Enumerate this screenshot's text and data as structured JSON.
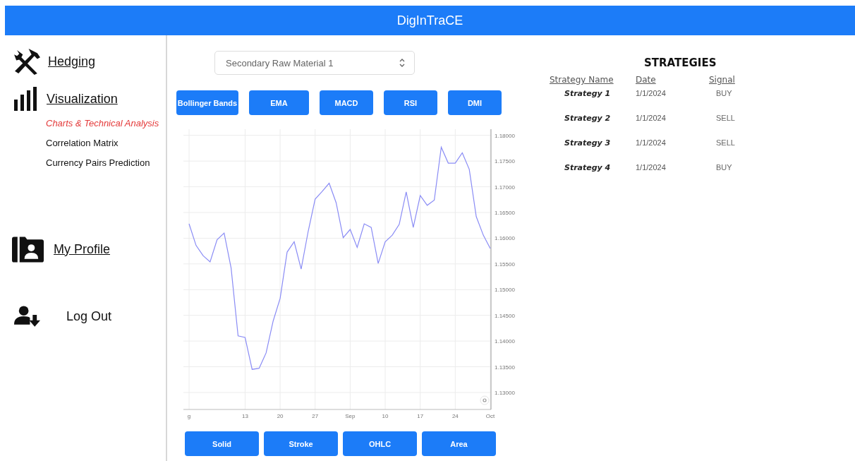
{
  "header": {
    "title": "DigInTraCE"
  },
  "sidebar": {
    "hedging": {
      "label": "Hedging"
    },
    "visualization": {
      "label": "Visualization",
      "children": [
        {
          "label": "Charts & Technical Analysis",
          "selected": true
        },
        {
          "label": "Correlation Matrix",
          "selected": false
        },
        {
          "label": "Currency Pairs Prediction",
          "selected": false
        }
      ]
    },
    "profile": {
      "label": "My Profile"
    },
    "logout": {
      "label": "Log Out"
    }
  },
  "material_select": {
    "value": "Secondary Raw Material 1"
  },
  "indicator_buttons": [
    "Bollinger Bands",
    "EMA",
    "MACD",
    "RSI",
    "DMI"
  ],
  "chart_data": {
    "type": "line",
    "categories": [
      "g",
      null,
      null,
      null,
      null,
      null,
      null,
      null,
      "13",
      null,
      null,
      null,
      null,
      "20",
      null,
      null,
      null,
      null,
      "27",
      null,
      null,
      null,
      null,
      "Sep",
      null,
      null,
      null,
      null,
      "10",
      null,
      null,
      null,
      null,
      "17",
      null,
      null,
      null,
      null,
      "24",
      null,
      null,
      null,
      null,
      "Oct"
    ],
    "series": [
      {
        "color": "#8a8cf5",
        "values": [
          1.1628,
          1.1586,
          1.1566,
          1.1554,
          1.1597,
          1.161,
          1.1542,
          1.141,
          1.1407,
          1.1345,
          1.1347,
          1.1377,
          1.1439,
          1.1483,
          1.1573,
          1.1593,
          1.154,
          1.1613,
          1.1676,
          1.1691,
          1.1707,
          1.1669,
          1.1601,
          1.1617,
          1.1582,
          1.1628,
          1.1621,
          1.1551,
          1.1593,
          1.1606,
          1.1627,
          1.169,
          1.1621,
          1.1683,
          1.1664,
          1.1674,
          1.1777,
          1.1746,
          1.1746,
          1.1766,
          1.1734,
          1.1642,
          1.1606,
          1.158
        ]
      }
    ],
    "grid": true,
    "ylim": [
      1.1267,
      1.1812
    ],
    "yticks": [
      {
        "value": 1.18,
        "label": "1.18000"
      },
      {
        "value": 1.175,
        "label": "1.17500"
      },
      {
        "value": 1.17,
        "label": "1.17000"
      },
      {
        "value": 1.165,
        "label": "1.16500"
      },
      {
        "value": 1.16,
        "label": "1.16000"
      },
      {
        "value": 1.155,
        "label": "1.15500"
      },
      {
        "value": 1.15,
        "label": "1.15000"
      },
      {
        "value": 1.145,
        "label": "1.14500"
      },
      {
        "value": 1.14,
        "label": "1.14000"
      },
      {
        "value": 1.135,
        "label": "1.13500"
      },
      {
        "value": 1.13,
        "label": "1.13000"
      }
    ]
  },
  "chart_type_buttons": [
    "Solid",
    "Stroke",
    "OHLC",
    "Area"
  ],
  "strategies": {
    "title": "STRATEGIES",
    "columns": [
      "Strategy Name",
      "Date",
      "Signal"
    ],
    "rows": [
      {
        "name": "Strategy 1",
        "date": "1/1/2024",
        "signal": "BUY"
      },
      {
        "name": "Strategy 2",
        "date": "1/1/2024",
        "signal": "SELL"
      },
      {
        "name": "Strategy 3",
        "date": "1/1/2024",
        "signal": "SELL"
      },
      {
        "name": "Strategy 4",
        "date": "1/1/2024",
        "signal": "BUY"
      }
    ]
  }
}
